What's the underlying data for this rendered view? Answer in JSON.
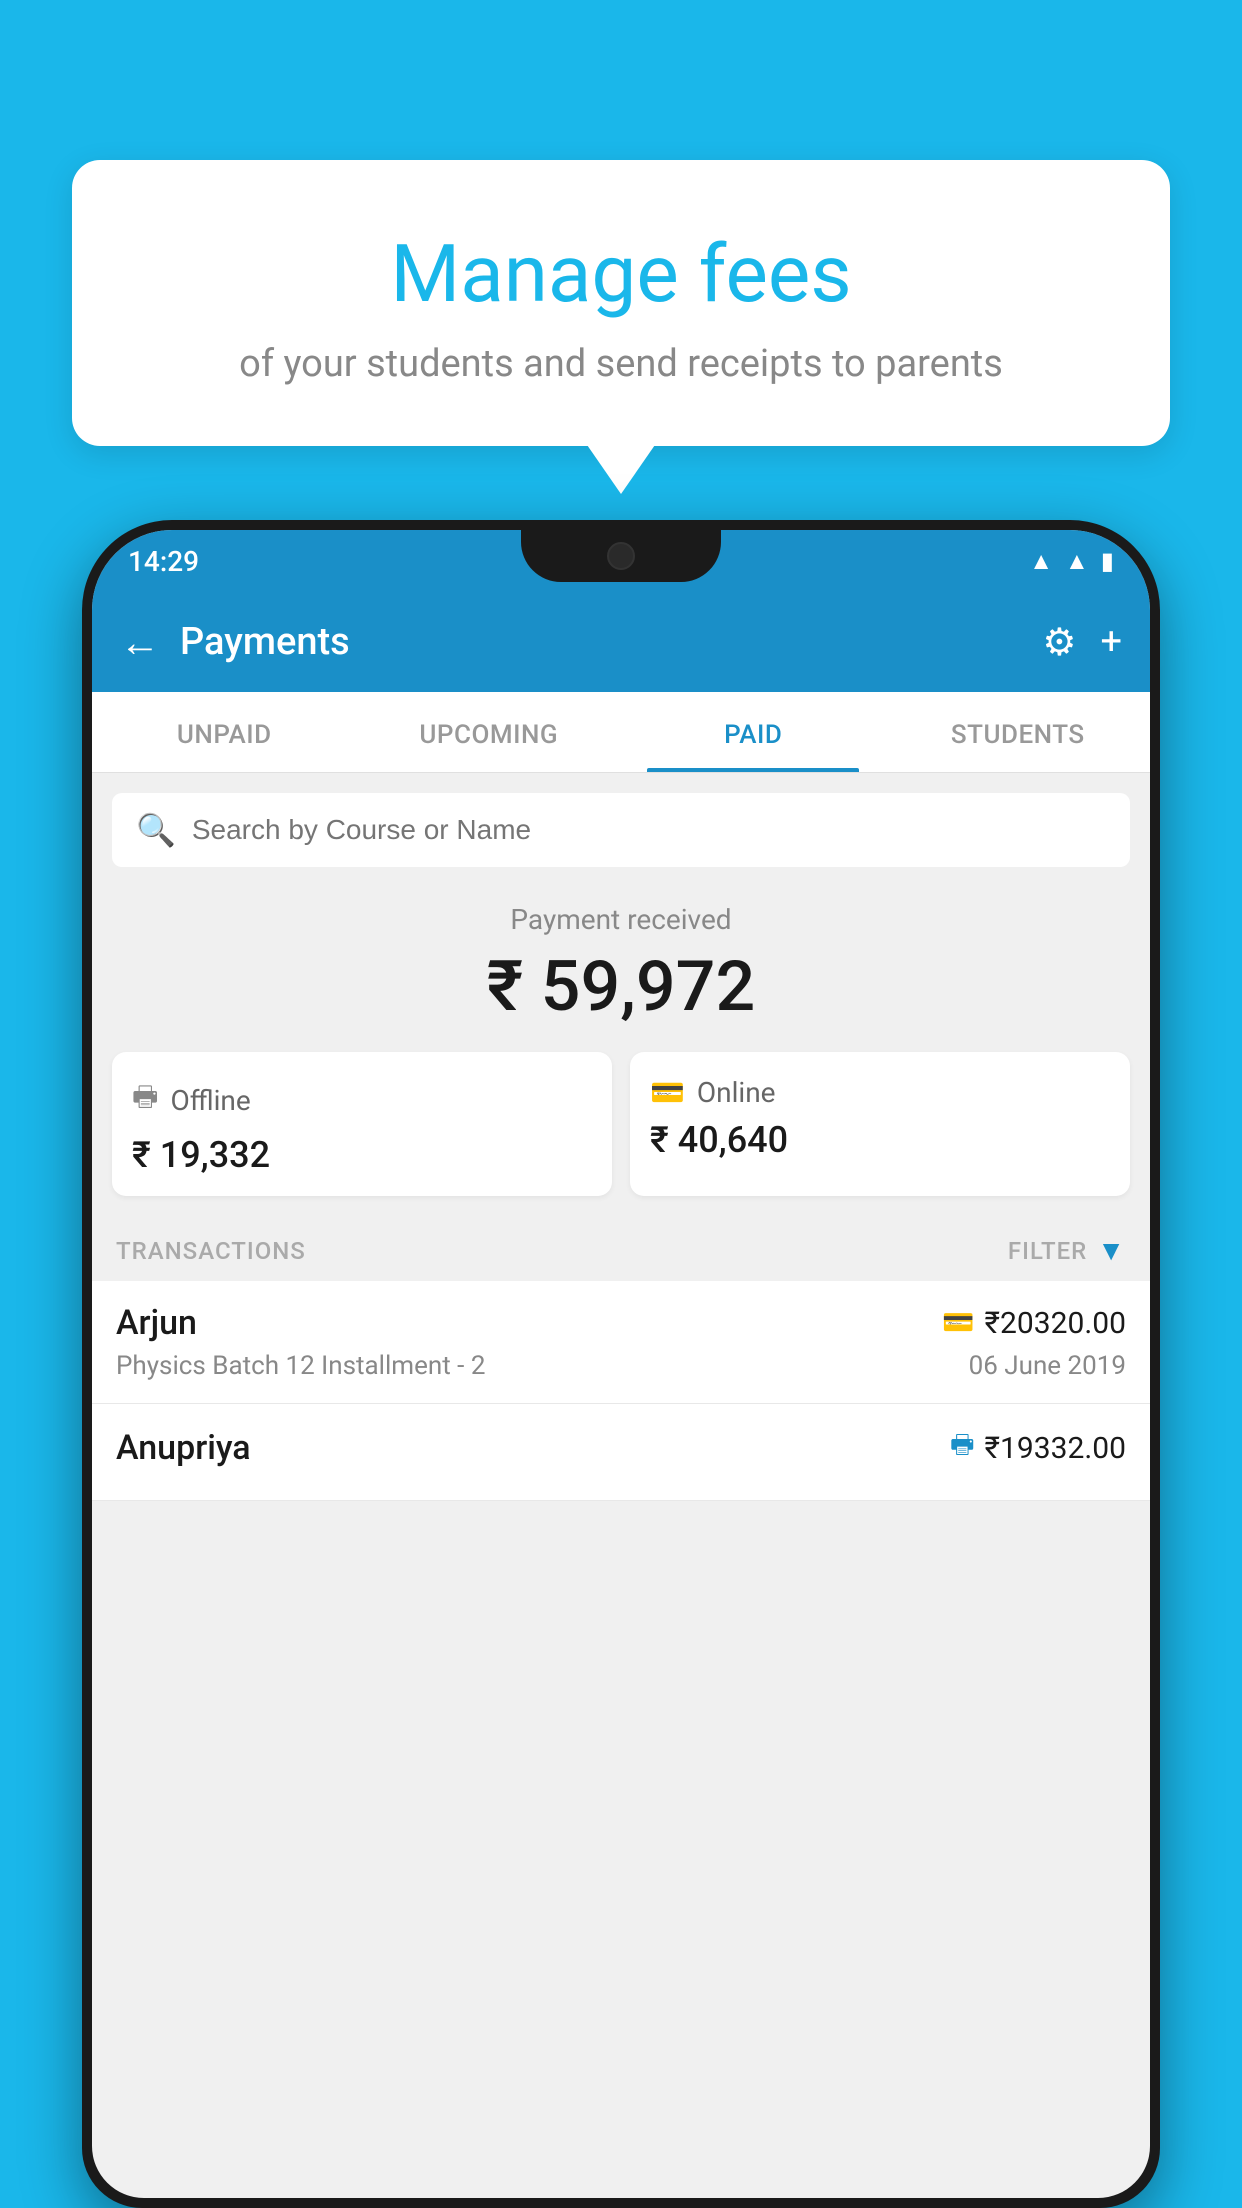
{
  "hero": {
    "title": "Manage fees",
    "subtitle": "of your students and send receipts to parents"
  },
  "status_bar": {
    "time": "14:29",
    "icons": [
      "wifi",
      "signal",
      "battery"
    ]
  },
  "app_bar": {
    "title": "Payments",
    "back_label": "←",
    "settings_label": "⚙",
    "add_label": "+"
  },
  "tabs": [
    {
      "label": "UNPAID",
      "active": false
    },
    {
      "label": "UPCOMING",
      "active": false
    },
    {
      "label": "PAID",
      "active": true
    },
    {
      "label": "STUDENTS",
      "active": false
    }
  ],
  "search": {
    "placeholder": "Search by Course or Name"
  },
  "payment_summary": {
    "label": "Payment received",
    "amount": "₹ 59,972",
    "offline_label": "Offline",
    "offline_amount": "₹ 19,332",
    "online_label": "Online",
    "online_amount": "₹ 40,640"
  },
  "transactions": {
    "header": "TRANSACTIONS",
    "filter": "FILTER",
    "items": [
      {
        "name": "Arjun",
        "course": "Physics Batch 12 Installment - 2",
        "amount": "₹20320.00",
        "date": "06 June 2019",
        "type": "online"
      },
      {
        "name": "Anupriya",
        "course": "",
        "amount": "₹19332.00",
        "date": "",
        "type": "offline"
      }
    ]
  }
}
